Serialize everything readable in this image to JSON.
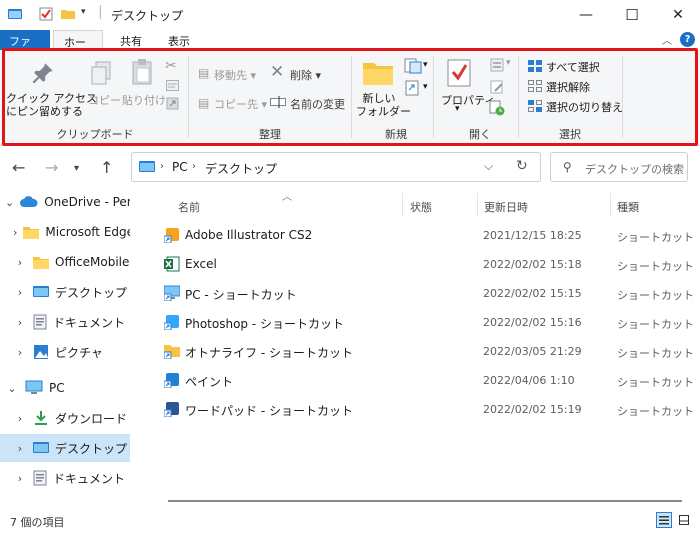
{
  "window": {
    "title": "デスクトップ",
    "controls": {
      "minimize": "—",
      "maximize": "☐",
      "close": "✕"
    }
  },
  "ribbon_tabs": {
    "file": "ファイル",
    "home": "ホーム",
    "share": "共有",
    "view": "表示",
    "help": "?"
  },
  "ribbon": {
    "clipboard": {
      "pin_label_1": "クイック アクセス",
      "pin_label_2": "にピン留めする",
      "copy": "コピー",
      "paste": "貼り付け",
      "group": "クリップボード"
    },
    "organize": {
      "move_to": "移動先",
      "copy_to": "コピー先",
      "delete": "削除",
      "rename": "名前の変更",
      "group": "整理"
    },
    "new": {
      "new_folder_1": "新しい",
      "new_folder_2": "フォルダー",
      "group": "新規"
    },
    "open": {
      "properties": "プロパティ",
      "group": "開く"
    },
    "select": {
      "select_all": "すべて選択",
      "select_none": "選択解除",
      "invert": "選択の切り替え",
      "group": "選択"
    }
  },
  "address": {
    "segments": [
      "PC",
      "デスクトップ"
    ],
    "search_placeholder": "デスクトップの検索"
  },
  "nav": [
    {
      "label": "OneDrive - Perso",
      "icon": "cloud-icon",
      "selected": false
    },
    {
      "label": "Microsoft Edge",
      "icon": "folder-icon",
      "selected": false
    },
    {
      "label": "OfficeMobile",
      "icon": "folder-icon",
      "selected": false
    },
    {
      "label": "デスクトップ",
      "icon": "desktop-icon",
      "selected": false
    },
    {
      "label": "ドキュメント",
      "icon": "document-icon",
      "selected": false
    },
    {
      "label": "ピクチャ",
      "icon": "picture-icon",
      "selected": false
    },
    {
      "label": "PC",
      "icon": "pc-icon",
      "selected": false
    },
    {
      "label": "ダウンロード",
      "icon": "download-icon",
      "selected": false
    },
    {
      "label": "デスクトップ",
      "icon": "desktop-icon",
      "selected": true
    },
    {
      "label": "ドキュメント",
      "icon": "document-icon",
      "selected": false
    }
  ],
  "columns": {
    "name": "名前",
    "status": "状態",
    "modified": "更新日時",
    "type": "種類"
  },
  "files": [
    {
      "name": "Adobe Illustrator CS2",
      "date": "2021/12/15 18:25",
      "type": "ショートカット",
      "icon": "illustrator-shortcut-icon",
      "color": "#f7a21b"
    },
    {
      "name": "Excel",
      "date": "2022/02/02 15:18",
      "type": "ショートカット",
      "icon": "excel-icon",
      "color": "#1e7145"
    },
    {
      "name": "PC - ショートカット",
      "date": "2022/02/02 15:15",
      "type": "ショートカット",
      "icon": "pc-shortcut-icon",
      "color": "#2b88d8"
    },
    {
      "name": "Photoshop - ショートカット",
      "date": "2022/02/02 15:16",
      "type": "ショートカット",
      "icon": "photoshop-shortcut-icon",
      "color": "#31a8ff"
    },
    {
      "name": "オトナライフ - ショートカット",
      "date": "2022/03/05 21:29",
      "type": "ショートカット",
      "icon": "folder-shortcut-icon",
      "color": "#f6c343"
    },
    {
      "name": "ペイント",
      "date": "2022/04/06 1:10",
      "type": "ショートカット",
      "icon": "paint-icon",
      "color": "#1f82d2"
    },
    {
      "name": "ワードパッド - ショートカット",
      "date": "2022/02/02 15:19",
      "type": "ショートカット",
      "icon": "wordpad-icon",
      "color": "#2b5797"
    }
  ],
  "status": {
    "item_count": "7 個の項目"
  },
  "colors": {
    "accent": "#1a6fc4",
    "highlight": "#e2141b",
    "selection": "#cce4f7"
  }
}
